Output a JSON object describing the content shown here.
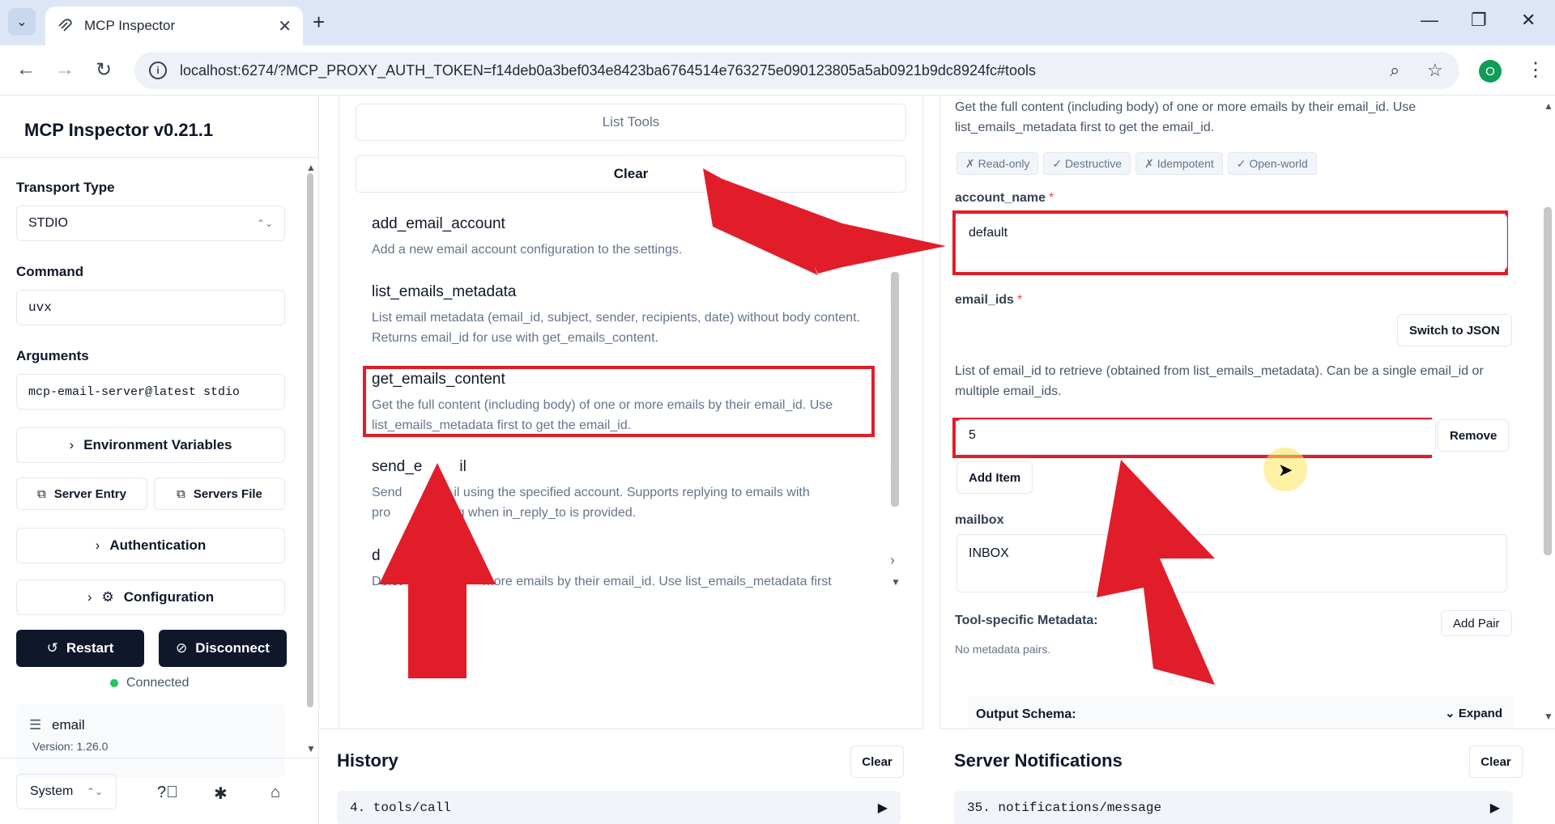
{
  "browser": {
    "tab_title": "MCP Inspector",
    "url": "localhost:6274/?MCP_PROXY_AUTH_TOKEN=f14deb0a3bef034e8423ba6764514e763275e090123805a5ab0921b9dc8924fc#tools",
    "profile_initial": "O"
  },
  "sidebar": {
    "title": "MCP Inspector v0.21.1",
    "transport_label": "Transport Type",
    "transport_value": "STDIO",
    "command_label": "Command",
    "command_value": "uvx",
    "arguments_label": "Arguments",
    "arguments_value": "mcp-email-server@latest stdio",
    "env_vars": "Environment Variables",
    "server_entry": "Server Entry",
    "servers_file": "Servers File",
    "authentication": "Authentication",
    "configuration": "Configuration",
    "restart": "Restart",
    "disconnect": "Disconnect",
    "status": "Connected",
    "server_name": "email",
    "server_version": "Version: 1.26.0",
    "theme": "System"
  },
  "tools": {
    "list_tools": "List Tools",
    "clear": "Clear",
    "items": [
      {
        "name": "add_email_account",
        "desc": "Add a new email account configuration to the settings."
      },
      {
        "name": "list_emails_metadata",
        "desc": "List email metadata (email_id, subject, sender, recipients, date) without body content. Returns email_id for use with get_emails_content."
      },
      {
        "name": "get_emails_content",
        "desc": "Get the full content (including body) of one or more emails by their email_id. Use list_emails_metadata first to get the email_id."
      },
      {
        "name": "send_e",
        "name_tail": "il",
        "desc_a": "Send",
        "desc_b": "il using the specified account. Supports replying to emails with",
        "desc_c": "pro",
        "desc_d": "ing when in_reply_to is provided."
      },
      {
        "name": "d",
        "desc_a": "Delet",
        "desc_b": "more emails by their email_id. Use list_emails_metadata first"
      }
    ]
  },
  "form": {
    "description": "Get the full content (including body) of one or more emails by their email_id. Use list_emails_metadata first to get the email_id.",
    "badges": [
      "✗ Read-only",
      "✓ Destructive",
      "✗ Idempotent",
      "✓ Open-world"
    ],
    "account_name_label": "account_name",
    "account_name_value": "default",
    "email_ids_label": "email_ids",
    "switch_json": "Switch to JSON",
    "email_ids_help": "List of email_id to retrieve (obtained from list_emails_metadata). Can be a single email_id or multiple email_ids.",
    "email_id_item": "5",
    "remove": "Remove",
    "add_item": "Add Item",
    "mailbox_label": "mailbox",
    "mailbox_value": "INBOX",
    "metadata_label": "Tool-specific Metadata:",
    "add_pair": "Add Pair",
    "no_metadata": "No metadata pairs.",
    "output_schema": "Output Schema:",
    "expand": "Expand"
  },
  "history": {
    "title": "History",
    "clear": "Clear",
    "entry": "4. tools/call"
  },
  "notifications": {
    "title": "Server Notifications",
    "clear": "Clear",
    "entry": "35. notifications/message"
  },
  "required_mark": "*",
  "colors": {
    "accent_dark": "#0f172a",
    "annotation_red": "#e11d2a",
    "connected_green": "#22c55e"
  }
}
